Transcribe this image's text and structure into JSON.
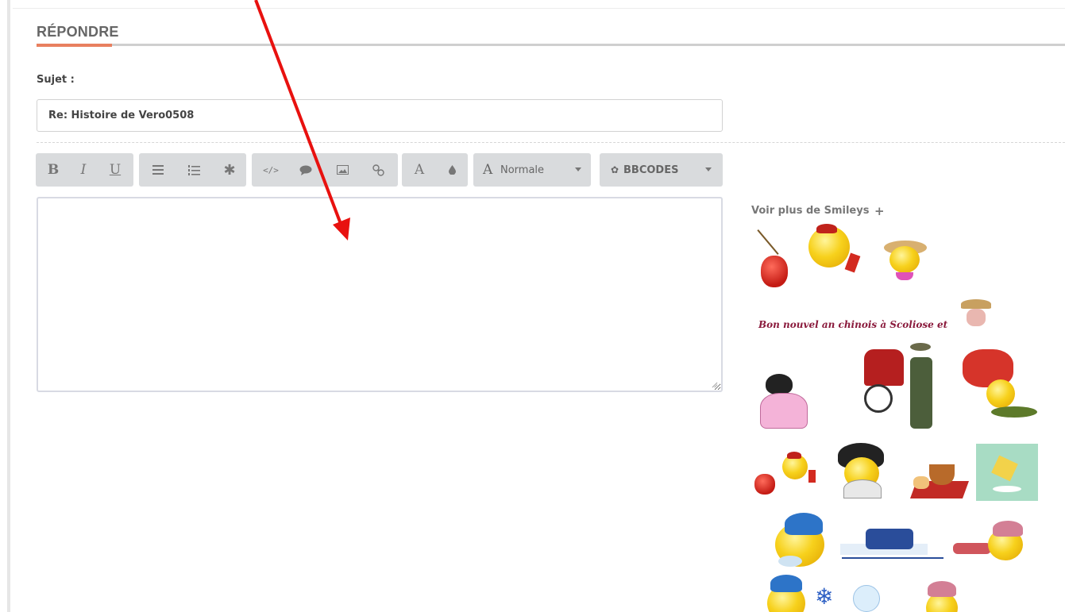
{
  "reply": {
    "title": "RÉPONDRE",
    "subject_label": "Sujet :",
    "subject_value": "Re: Histoire de Vero0508"
  },
  "toolbar": {
    "bold": "B",
    "italic": "I",
    "underline": "U",
    "color_letter": "A",
    "size_letter": "A",
    "size_value": "Normale",
    "bbcodes": "BBCODES"
  },
  "smileys": {
    "more_link": "Voir plus de Smileys",
    "plus": "+",
    "banner": "Bon nouvel an chinois à Scoliose et"
  },
  "colors": {
    "accent": "#e8805f",
    "annotation_arrow": "#e8110f",
    "toolbar_bg": "#d9dbdd"
  }
}
